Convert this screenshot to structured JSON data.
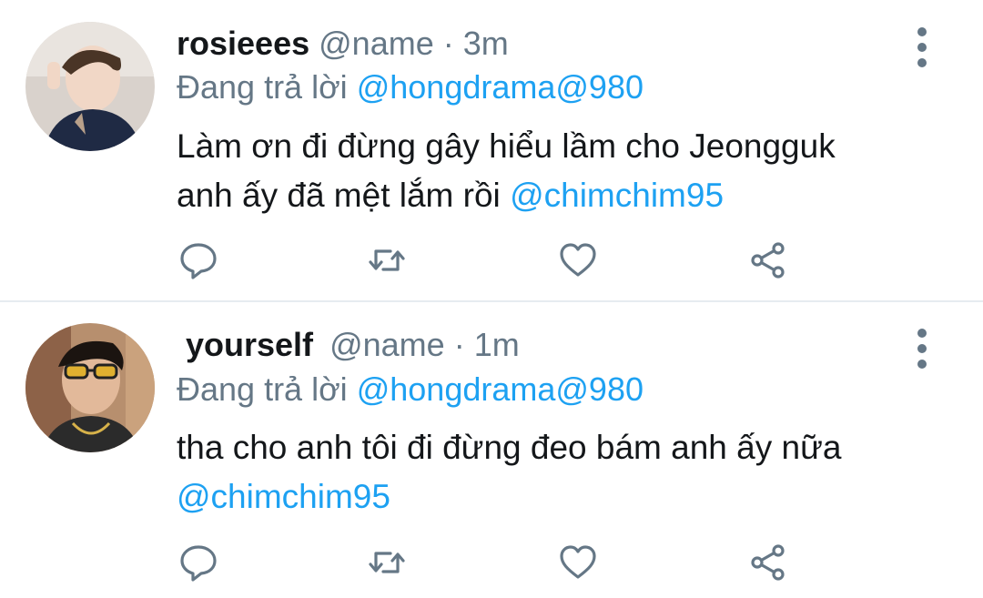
{
  "tweets": [
    {
      "name": "rosieees",
      "handle": "@name",
      "dot": "·",
      "time": "3m",
      "replying_prefix": "Đang trả lời",
      "replying_to": "@hongdrama@980",
      "text_line1": "Làm ơn đi đừng gây hiểu lầm cho Jeongguk",
      "text_line2": "anh ấy đã mệt lắm rồi",
      "mention": "@chimchim95"
    },
    {
      "name": "yourself",
      "handle": "@name",
      "dot": "·",
      "time": "1m",
      "replying_prefix": "Đang trả lời",
      "replying_to": "@hongdrama@980",
      "text_line1": "tha cho anh tôi đi đừng đeo bám anh ấy nữa",
      "mention": "@chimchim95"
    }
  ],
  "colors": {
    "link": "#1da1f2",
    "secondary": "#657786",
    "divider": "#e6ecf0"
  },
  "icons": [
    "reply-icon",
    "retweet-icon",
    "like-icon",
    "share-icon",
    "more-vertical-icon"
  ]
}
